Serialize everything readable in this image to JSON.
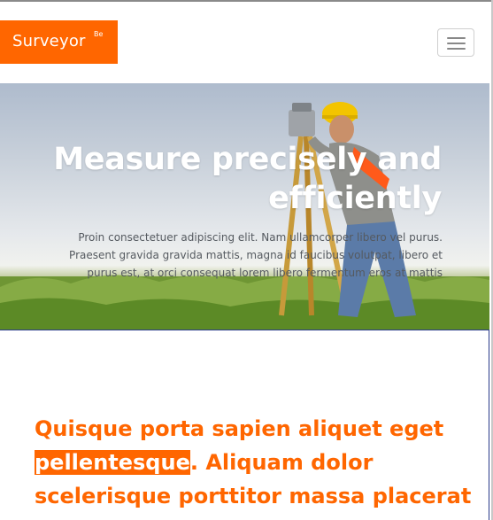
{
  "header": {
    "logo_text": "Surveyor",
    "logo_sup": "Be",
    "menu_button_icon": "hamburger-menu-icon"
  },
  "hero": {
    "title": "Measure precisely and efficiently",
    "text": "Proin consectetuer adipiscing elit. Nam ullamcorper libero vel purus. Praesent gravida gravida mattis, magna id faucibus volutpat, libero et purus est, at orci consequat lorem libero fermentum eros at mattis"
  },
  "content": {
    "headline_before": "Quisque porta sapien aliquet eget ",
    "headline_highlight": "pellentesque",
    "headline_after": ". Aliquam dolor scelerisque porttitor massa placerat"
  },
  "colors": {
    "accent": "#ff6600",
    "hero_text": "#555a60",
    "border_blue": "#2a3a8a"
  }
}
